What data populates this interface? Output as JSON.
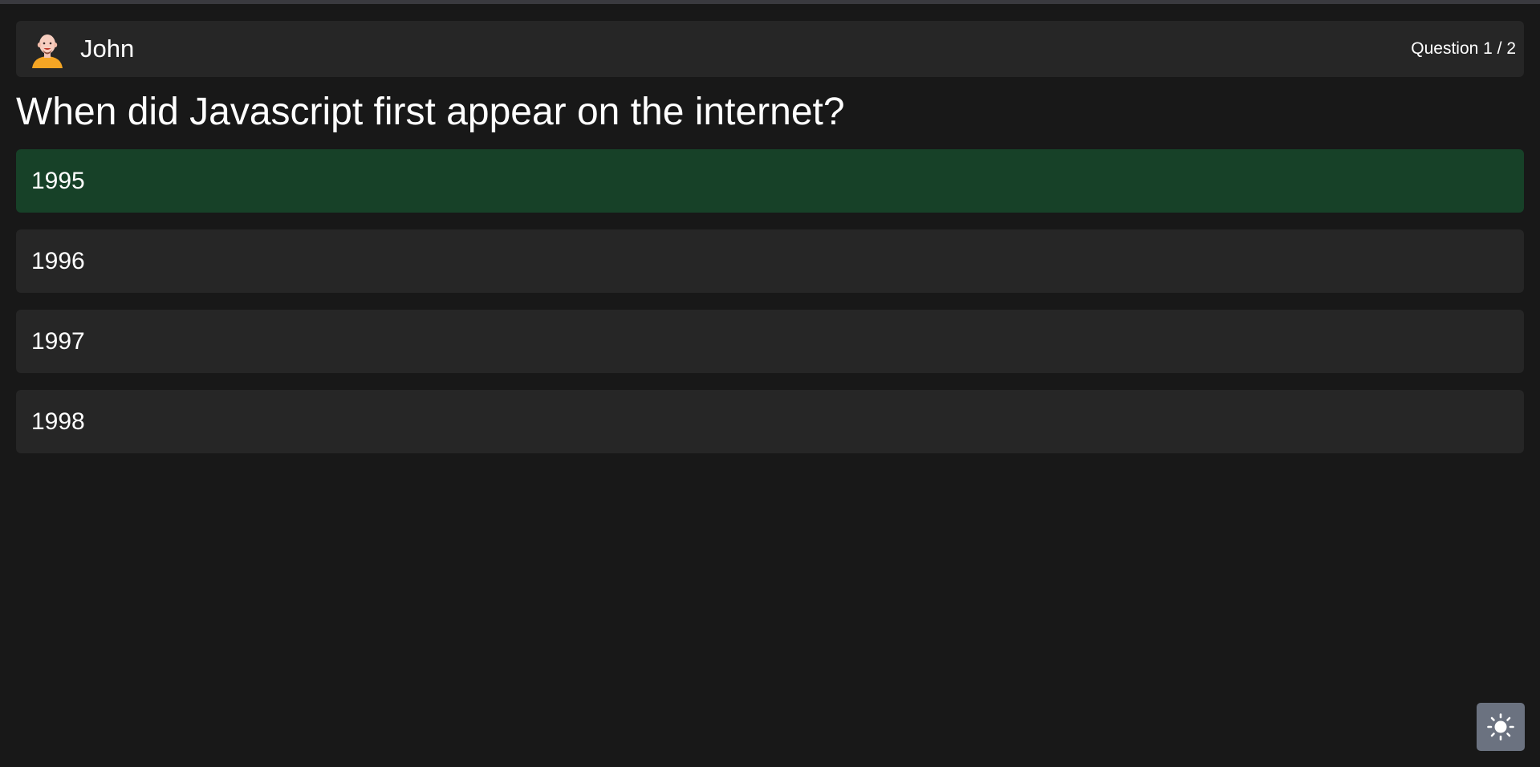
{
  "header": {
    "username": "John",
    "progress": "Question 1 / 2"
  },
  "question": {
    "text": "When did Javascript first appear on the internet?"
  },
  "answers": [
    {
      "label": "1995",
      "selected": true
    },
    {
      "label": "1996",
      "selected": false
    },
    {
      "label": "1997",
      "selected": false
    },
    {
      "label": "1998",
      "selected": false
    }
  ],
  "icons": {
    "avatar": "avatar-icon",
    "theme_toggle": "sun-icon"
  },
  "colors": {
    "background": "#181818",
    "card": "#262626",
    "selected_answer": "#174128",
    "toggle_button": "#6b7280"
  }
}
